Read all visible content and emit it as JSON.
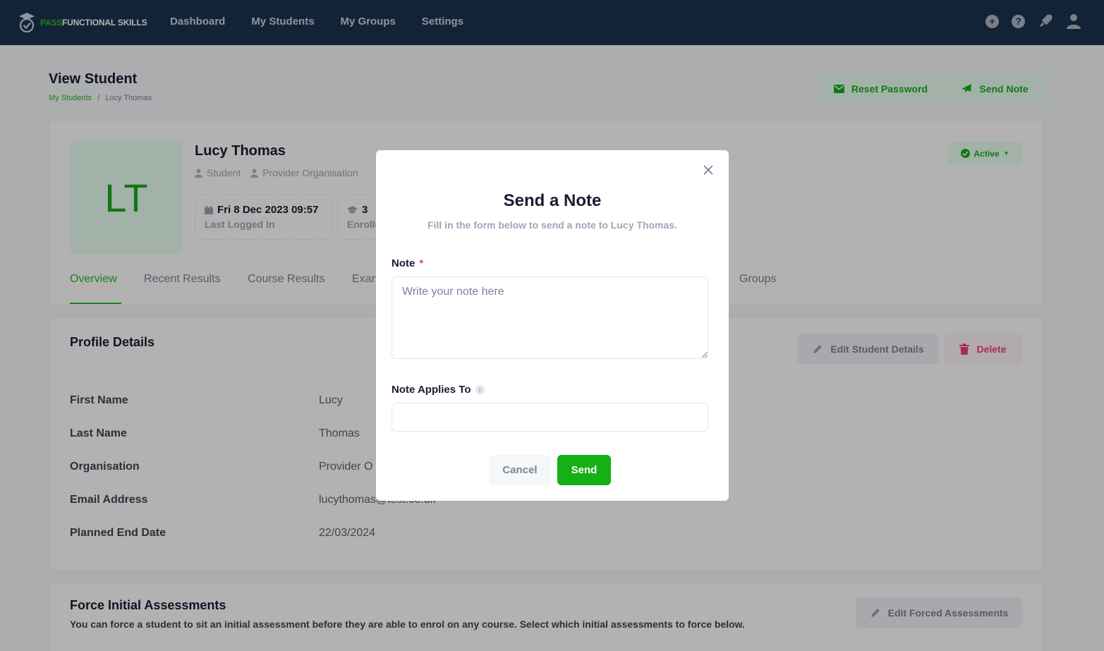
{
  "brand": {
    "part1": "PASS",
    "part2": "FUNCTIONAL SKILLS"
  },
  "nav": [
    "Dashboard",
    "My Students",
    "My Groups",
    "Settings"
  ],
  "topbar_icons": [
    "plus-circle-icon",
    "help-icon",
    "rocket-icon",
    "user-icon"
  ],
  "page": {
    "title": "View Student",
    "breadcrumb": {
      "link": "My Students",
      "sep": "/",
      "current": "Lucy Thomas"
    },
    "reset_password": "Reset Password",
    "send_note": "Send Note"
  },
  "student": {
    "initials": "LT",
    "name": "Lucy Thomas",
    "role": "Student",
    "org": "Provider Organisation",
    "last_login": "Fri 8 Dec 2023 09:57",
    "last_login_label": "Last Logged In",
    "enrolled": "3",
    "enrolled_label": "Enrolle",
    "status": "Active"
  },
  "tabs": [
    "Overview",
    "Recent Results",
    "Course Results",
    "Exan",
    "Groups"
  ],
  "profile": {
    "title": "Profile Details",
    "edit": "Edit Student Details",
    "delete": "Delete",
    "rows": [
      {
        "label": "First Name",
        "value": "Lucy"
      },
      {
        "label": "Last Name",
        "value": "Thomas"
      },
      {
        "label": "Organisation",
        "value": "Provider O"
      },
      {
        "label": "Email Address",
        "value": "lucythomas@test.co.uk"
      },
      {
        "label": "Planned End Date",
        "value": "22/03/2024"
      }
    ]
  },
  "force": {
    "title": "Force Initial Assessments",
    "desc": "You can force a student to sit an initial assessment before they are able to enrol on any course. Select which initial assessments to force below.",
    "edit": "Edit Forced Assessments"
  },
  "modal": {
    "title": "Send a Note",
    "subtitle": "Fill in the form below to send a note to Lucy Thomas.",
    "note_label": "Note",
    "required": "*",
    "note_placeholder": "Write your note here",
    "applies_label": "Note Applies To",
    "info": "i",
    "cancel": "Cancel",
    "send": "Send"
  },
  "colors": {
    "brand_green": "#2bb52b",
    "topbar": "#1c3350",
    "send_button": "#15b015",
    "danger": "#f1416c"
  }
}
